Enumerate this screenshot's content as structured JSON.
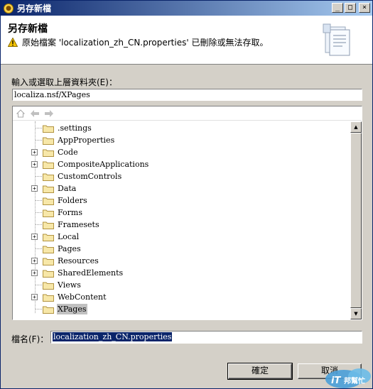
{
  "window": {
    "title": "另存新檔",
    "icon": "app-icon"
  },
  "header": {
    "title": "另存新檔",
    "message": "原始檔案 'localization_zh_CN.properties' 已刪除或無法存取。"
  },
  "directory": {
    "label": "輸入或選取上層資料夾(E)：",
    "value": "localiza.nsf/XPages"
  },
  "tree": {
    "items": [
      {
        "label": ".settings",
        "expandable": false
      },
      {
        "label": "AppProperties",
        "expandable": false
      },
      {
        "label": "Code",
        "expandable": true
      },
      {
        "label": "CompositeApplications",
        "expandable": true
      },
      {
        "label": "CustomControls",
        "expandable": false
      },
      {
        "label": "Data",
        "expandable": true
      },
      {
        "label": "Folders",
        "expandable": false
      },
      {
        "label": "Forms",
        "expandable": false
      },
      {
        "label": "Framesets",
        "expandable": false
      },
      {
        "label": "Local",
        "expandable": true
      },
      {
        "label": "Pages",
        "expandable": false
      },
      {
        "label": "Resources",
        "expandable": true
      },
      {
        "label": "SharedElements",
        "expandable": true
      },
      {
        "label": "Views",
        "expandable": false
      },
      {
        "label": "WebContent",
        "expandable": true
      },
      {
        "label": "XPages",
        "expandable": false,
        "selected": true
      }
    ]
  },
  "filename": {
    "label": "檔名(F)：",
    "value": "localization_zh_CN.properties"
  },
  "buttons": {
    "ok": "確定",
    "cancel": "取消"
  },
  "watermark": {
    "text": "iT邦幫忙"
  }
}
